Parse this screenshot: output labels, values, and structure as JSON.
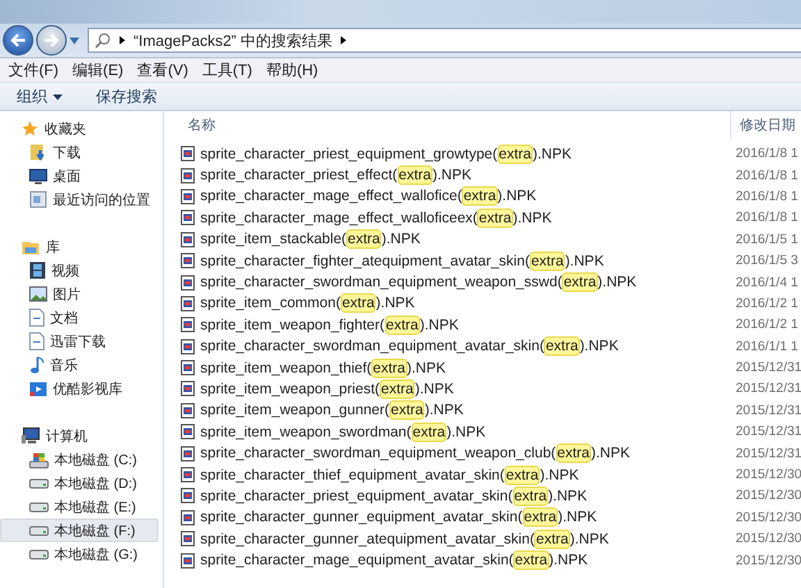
{
  "address_bar": {
    "path": "“ImagePacks2” 中的搜索结果"
  },
  "menu": [
    "文件(F)",
    "编辑(E)",
    "查看(V)",
    "工具(T)",
    "帮助(H)"
  ],
  "toolbar": [
    {
      "label": "组织",
      "kind": "dropdown"
    },
    {
      "label": "保存搜索",
      "kind": "button"
    }
  ],
  "sidebar": [
    {
      "label": "收藏夹",
      "selected": false,
      "children": [
        {
          "label": "下载",
          "selected": false
        },
        {
          "label": "桌面",
          "selected": false
        },
        {
          "label": "最近访问的位置",
          "selected": false
        }
      ]
    },
    {
      "label": "库",
      "selected": false,
      "children": [
        {
          "label": "视频",
          "selected": false
        },
        {
          "label": "图片",
          "selected": false
        },
        {
          "label": "文档",
          "selected": false
        },
        {
          "label": "迅雷下载",
          "selected": false
        },
        {
          "label": "音乐",
          "selected": false
        },
        {
          "label": "优酷影视库",
          "selected": false
        }
      ]
    },
    {
      "label": "计算机",
      "selected": false,
      "children": [
        {
          "label": "本地磁盘 (C:)",
          "selected": false
        },
        {
          "label": "本地磁盘 (D:)",
          "selected": false
        },
        {
          "label": "本地磁盘 (E:)",
          "selected": false
        },
        {
          "label": "本地磁盘 (F:)",
          "selected": true
        },
        {
          "label": "本地磁盘 (G:)",
          "selected": false
        }
      ]
    }
  ],
  "table": {
    "columns": [
      "名称",
      "修改日期"
    ],
    "rows": [
      {
        "name": [
          "sprite_character_priest_equipment_growtype(",
          "extra",
          ").NPK"
        ],
        "date": "2016/1/8 1"
      },
      {
        "name": [
          "sprite_character_priest_effect(",
          "extra",
          ").NPK"
        ],
        "date": "2016/1/8 1"
      },
      {
        "name": [
          "sprite_character_mage_effect_wallofice(",
          "extra",
          ").NPK"
        ],
        "date": "2016/1/8 1"
      },
      {
        "name": [
          "sprite_character_mage_effect_walloficeex(",
          "extra",
          ").NPK"
        ],
        "date": "2016/1/8 1"
      },
      {
        "name": [
          "sprite_item_stackable(",
          "extra",
          ").NPK"
        ],
        "date": "2016/1/5 1"
      },
      {
        "name": [
          "sprite_character_fighter_atequipment_avatar_skin(",
          "extra",
          ").NPK"
        ],
        "date": "2016/1/5 3"
      },
      {
        "name": [
          "sprite_character_swordman_equipment_weapon_sswd(",
          "extra",
          ").NPK"
        ],
        "date": "2016/1/4 1"
      },
      {
        "name": [
          "sprite_item_common(",
          "extra",
          ").NPK"
        ],
        "date": "2016/1/2 1"
      },
      {
        "name": [
          "sprite_item_weapon_fighter(",
          "extra",
          ").NPK"
        ],
        "date": "2016/1/2 1"
      },
      {
        "name": [
          "sprite_character_swordman_equipment_avatar_skin(",
          "extra",
          ").NPK"
        ],
        "date": "2016/1/1 1"
      },
      {
        "name": [
          "sprite_item_weapon_thief(",
          "extra",
          ").NPK"
        ],
        "date": "2015/12/31"
      },
      {
        "name": [
          "sprite_item_weapon_priest(",
          "extra",
          ").NPK"
        ],
        "date": "2015/12/31"
      },
      {
        "name": [
          "sprite_item_weapon_gunner(",
          "extra",
          ").NPK"
        ],
        "date": "2015/12/31"
      },
      {
        "name": [
          "sprite_item_weapon_swordman(",
          "extra",
          ").NPK"
        ],
        "date": "2015/12/31"
      },
      {
        "name": [
          "sprite_character_swordman_equipment_weapon_club(",
          "extra",
          ").NPK"
        ],
        "date": "2015/12/31"
      },
      {
        "name": [
          "sprite_character_thief_equipment_avatar_skin(",
          "extra",
          ").NPK"
        ],
        "date": "2015/12/30"
      },
      {
        "name": [
          "sprite_character_priest_equipment_avatar_skin(",
          "extra",
          ").NPK"
        ],
        "date": "2015/12/30"
      },
      {
        "name": [
          "sprite_character_gunner_equipment_avatar_skin(",
          "extra",
          ").NPK"
        ],
        "date": "2015/12/30"
      },
      {
        "name": [
          "sprite_character_gunner_atequipment_avatar_skin(",
          "extra",
          ").NPK"
        ],
        "date": "2015/12/30"
      },
      {
        "name": [
          "sprite_character_mage_equipment_avatar_skin(",
          "extra",
          ").NPK"
        ],
        "date": "2015/12/30"
      }
    ]
  }
}
